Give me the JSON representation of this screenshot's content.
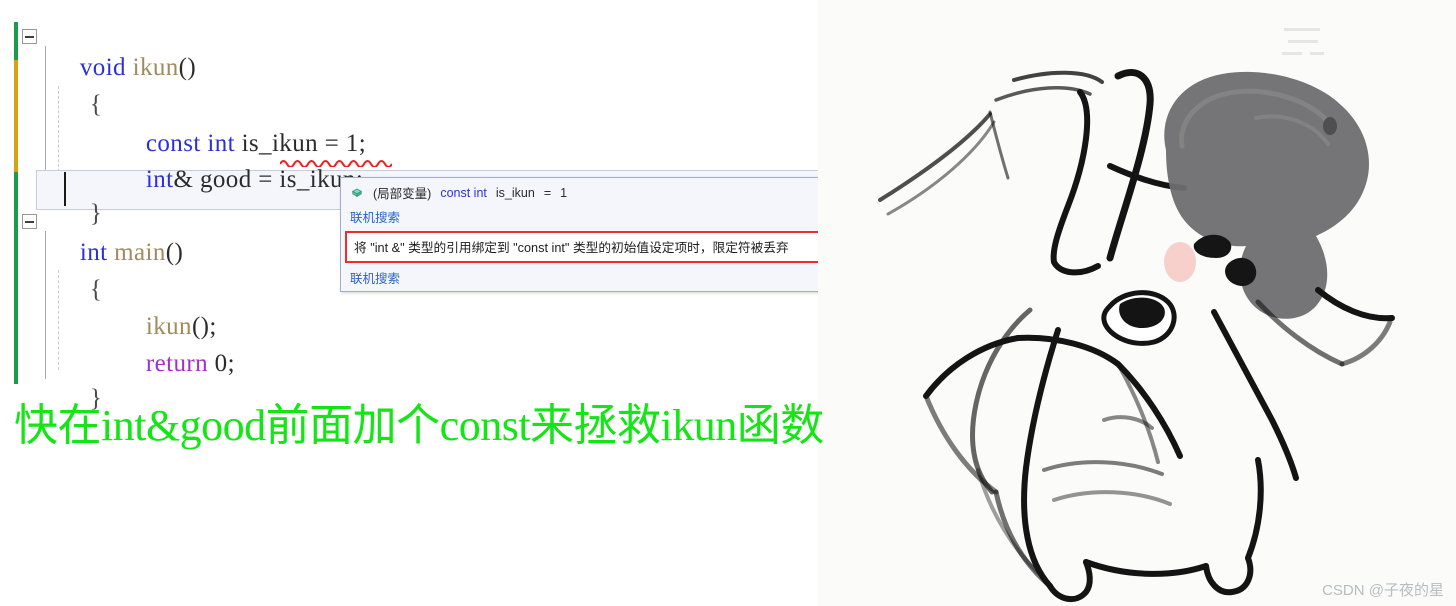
{
  "editor": {
    "language": "cpp",
    "lines": [
      {
        "indent": 0,
        "tokens": [
          {
            "t": "void",
            "c": "kw"
          },
          {
            "t": " ",
            "c": "plain"
          },
          {
            "t": "ikun",
            "c": "fnname"
          },
          {
            "t": "()",
            "c": "plain"
          }
        ]
      },
      {
        "indent": 1,
        "tokens": [
          {
            "t": "{",
            "c": "brace"
          }
        ]
      },
      {
        "indent": 2,
        "tokens": [
          {
            "t": "const",
            "c": "kw"
          },
          {
            "t": " ",
            "c": "plain"
          },
          {
            "t": "int",
            "c": "kw"
          },
          {
            "t": " is_ikun = ",
            "c": "plain"
          },
          {
            "t": "1",
            "c": "num"
          },
          {
            "t": ";",
            "c": "plain"
          }
        ]
      },
      {
        "indent": 2,
        "tokens": [
          {
            "t": "int",
            "c": "kw"
          },
          {
            "t": "& good = is_ikun;",
            "c": "plain"
          }
        ]
      },
      {
        "indent": 1,
        "tokens": [
          {
            "t": "}",
            "c": "brace"
          }
        ]
      },
      {
        "indent": 0,
        "tokens": [
          {
            "t": "int",
            "c": "kw"
          },
          {
            "t": " ",
            "c": "plain"
          },
          {
            "t": "main",
            "c": "fnname"
          },
          {
            "t": "()",
            "c": "plain"
          }
        ]
      },
      {
        "indent": 1,
        "tokens": [
          {
            "t": "{",
            "c": "brace"
          }
        ]
      },
      {
        "indent": 2,
        "tokens": [
          {
            "t": "ikun",
            "c": "fnname"
          },
          {
            "t": "();",
            "c": "plain"
          }
        ]
      },
      {
        "indent": 2,
        "tokens": [
          {
            "t": "return",
            "c": "ret"
          },
          {
            "t": " ",
            "c": "plain"
          },
          {
            "t": "0",
            "c": "num"
          },
          {
            "t": ";",
            "c": "plain"
          }
        ]
      },
      {
        "indent": 1,
        "tokens": [
          {
            "t": "}",
            "c": "brace"
          }
        ]
      }
    ],
    "line_texts": [
      "void ikun()",
      "{",
      "const int is_ikun = 1;",
      "int& good = is_ikun;",
      "}",
      "int main()",
      "{",
      "ikun();",
      "return 0;",
      "}"
    ],
    "error_underline_token": "is_ikun",
    "colors": {
      "keyword": "#2b31d6",
      "function": "#a08b5c",
      "return_keyword": "#a331c4",
      "plain": "#2b2b2b",
      "squiggle": "#ee2020",
      "change_bar_saved": "#1d9b4d",
      "change_bar_unsaved": "#d9a010",
      "current_line_bg": "#f4f6fc",
      "current_line_border": "#c6cbdd"
    }
  },
  "tooltip": {
    "icon": "local-variable-icon",
    "signature": {
      "kind_label": "(局部变量)",
      "type_keyword": "const int",
      "identifier": "is_ikun",
      "equals": "=",
      "value": "1",
      "full": "(局部变量) const int is_ikun = 1"
    },
    "link_top": "联机搜索",
    "error_message": "将 \"int &\" 类型的引用绑定到 \"const int\" 类型的初始值设定项时，限定符被丢弃",
    "link_bottom": "联机搜索",
    "border_color": "#a6aec6",
    "background": "#f4f6fc",
    "error_border_color": "#ef2d2d",
    "link_color": "#2b63c8"
  },
  "caption": {
    "text": "快在int&good前面加个const来拯救ikun函数",
    "color": "#14e514"
  },
  "meme": {
    "alt": "ikun-cartoon-drawing",
    "description": "黑白手绘卡通人物"
  },
  "watermark": {
    "text": "CSDN @子夜的星",
    "color": "#b9bcc1"
  }
}
